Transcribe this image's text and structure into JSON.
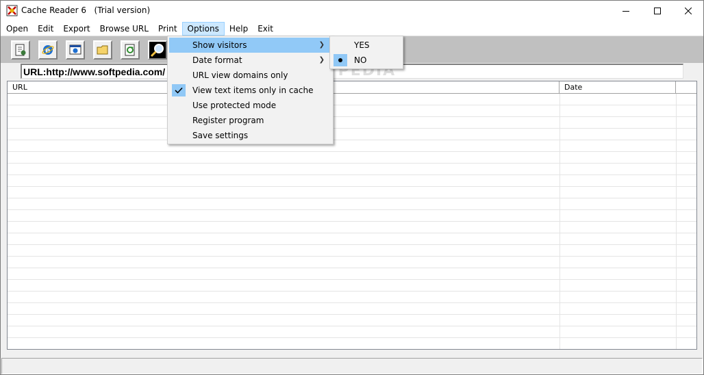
{
  "window": {
    "title": "Cache Reader 6",
    "subtitle": "(Trial version)"
  },
  "menubar": {
    "items": [
      "Open",
      "Edit",
      "Export",
      "Browse URL",
      "Print",
      "Options",
      "Help",
      "Exit"
    ]
  },
  "toolbar": {
    "icons": [
      "open-cache-icon",
      "internet-explorer-icon",
      "browse-url-icon",
      "folder-icon",
      "refresh-icon",
      "search-icon"
    ]
  },
  "url_bar": {
    "value": "URL:http://www.softpedia.com/"
  },
  "list": {
    "columns": [
      "URL",
      "Date"
    ]
  },
  "options_menu": {
    "items": [
      {
        "label": "Show visitors",
        "submenu": true,
        "highlighted": true,
        "checked": false
      },
      {
        "label": "Date format",
        "submenu": true,
        "highlighted": false,
        "checked": false
      },
      {
        "label": "URL view domains only",
        "submenu": false,
        "highlighted": false,
        "checked": false
      },
      {
        "label": "View text items only in cache",
        "submenu": false,
        "highlighted": false,
        "checked": true
      },
      {
        "label": "Use protected mode",
        "submenu": false,
        "highlighted": false,
        "checked": false
      },
      {
        "label": "Register program",
        "submenu": false,
        "highlighted": false,
        "checked": false
      },
      {
        "label": "Save settings",
        "submenu": false,
        "highlighted": false,
        "checked": false
      }
    ]
  },
  "show_visitors_submenu": {
    "items": [
      {
        "label": "YES",
        "selected": false
      },
      {
        "label": "NO",
        "selected": true
      }
    ]
  },
  "watermark": "SOFTPEDIA",
  "colors": {
    "menu_highlight": "#91c9f7",
    "open_menu": "#cce8ff",
    "toolbar_bg": "#c0c0c0"
  }
}
